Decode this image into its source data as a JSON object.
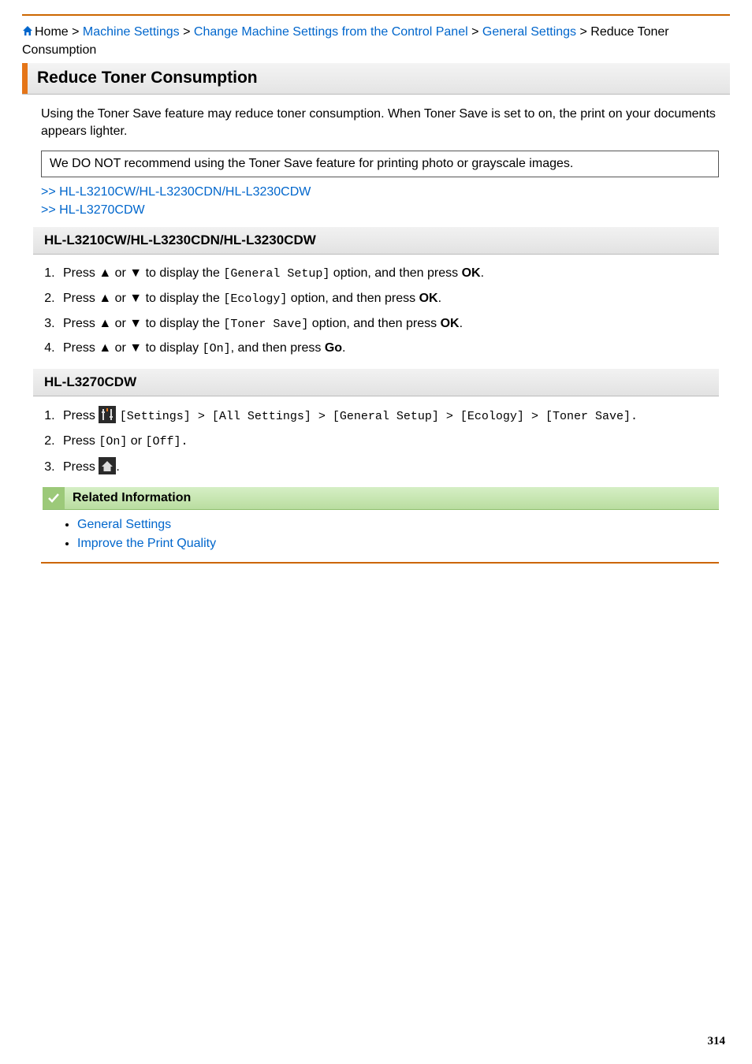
{
  "breadcrumb": {
    "home": "Home",
    "sep": " > ",
    "items": [
      "Machine Settings",
      "Change Machine Settings from the Control Panel",
      "General Settings"
    ],
    "current": "Reduce Toner Consumption"
  },
  "title": "Reduce Toner Consumption",
  "intro": "Using the Toner Save feature may reduce toner consumption. When Toner Save is set to on, the print on your documents appears lighter.",
  "note": "We DO NOT recommend using the Toner Save feature for printing photo or grayscale images.",
  "anchors": {
    "a1": ">> HL-L3210CW/HL-L3230CDN/HL-L3230CDW",
    "a2": ">> HL-L3270CDW"
  },
  "section1": {
    "heading": "HL-L3210CW/HL-L3230CDN/HL-L3230CDW",
    "steps": {
      "s1": {
        "pre": "Press ▲ or ▼ to display the ",
        "code": "[General Setup]",
        "mid": " option, and then press ",
        "btn": "OK",
        "post": "."
      },
      "s2": {
        "pre": "Press ▲ or ▼ to display the ",
        "code": "[Ecology]",
        "mid": " option, and then press ",
        "btn": "OK",
        "post": "."
      },
      "s3": {
        "pre": "Press ▲ or ▼ to display the ",
        "code": "[Toner Save]",
        "mid": " option, and then press ",
        "btn": "OK",
        "post": "."
      },
      "s4": {
        "pre": "Press ▲ or ▼ to display ",
        "code": "[On]",
        "mid": ", and then press ",
        "btn": "Go",
        "post": "."
      }
    }
  },
  "section2": {
    "heading": "HL-L3270CDW",
    "steps": {
      "s1": {
        "pre": "Press ",
        "code1": "[Settings]",
        "sep1": " > ",
        "code2": "[All Settings]",
        "sep2": " > ",
        "code3": "[General Setup]",
        "sep3": " > ",
        "code4": "[Ecology]",
        "sep4": " > ",
        "code5": "[Toner Save].",
        "post": ""
      },
      "s2": {
        "pre": "Press ",
        "code1": "[On]",
        "mid": " or ",
        "code2": "[Off].",
        "post": ""
      },
      "s3": {
        "pre": "Press ",
        "post": "."
      }
    }
  },
  "related": {
    "title": "Related Information",
    "items": [
      "General Settings",
      "Improve the Print Quality"
    ]
  },
  "page_number": "314"
}
